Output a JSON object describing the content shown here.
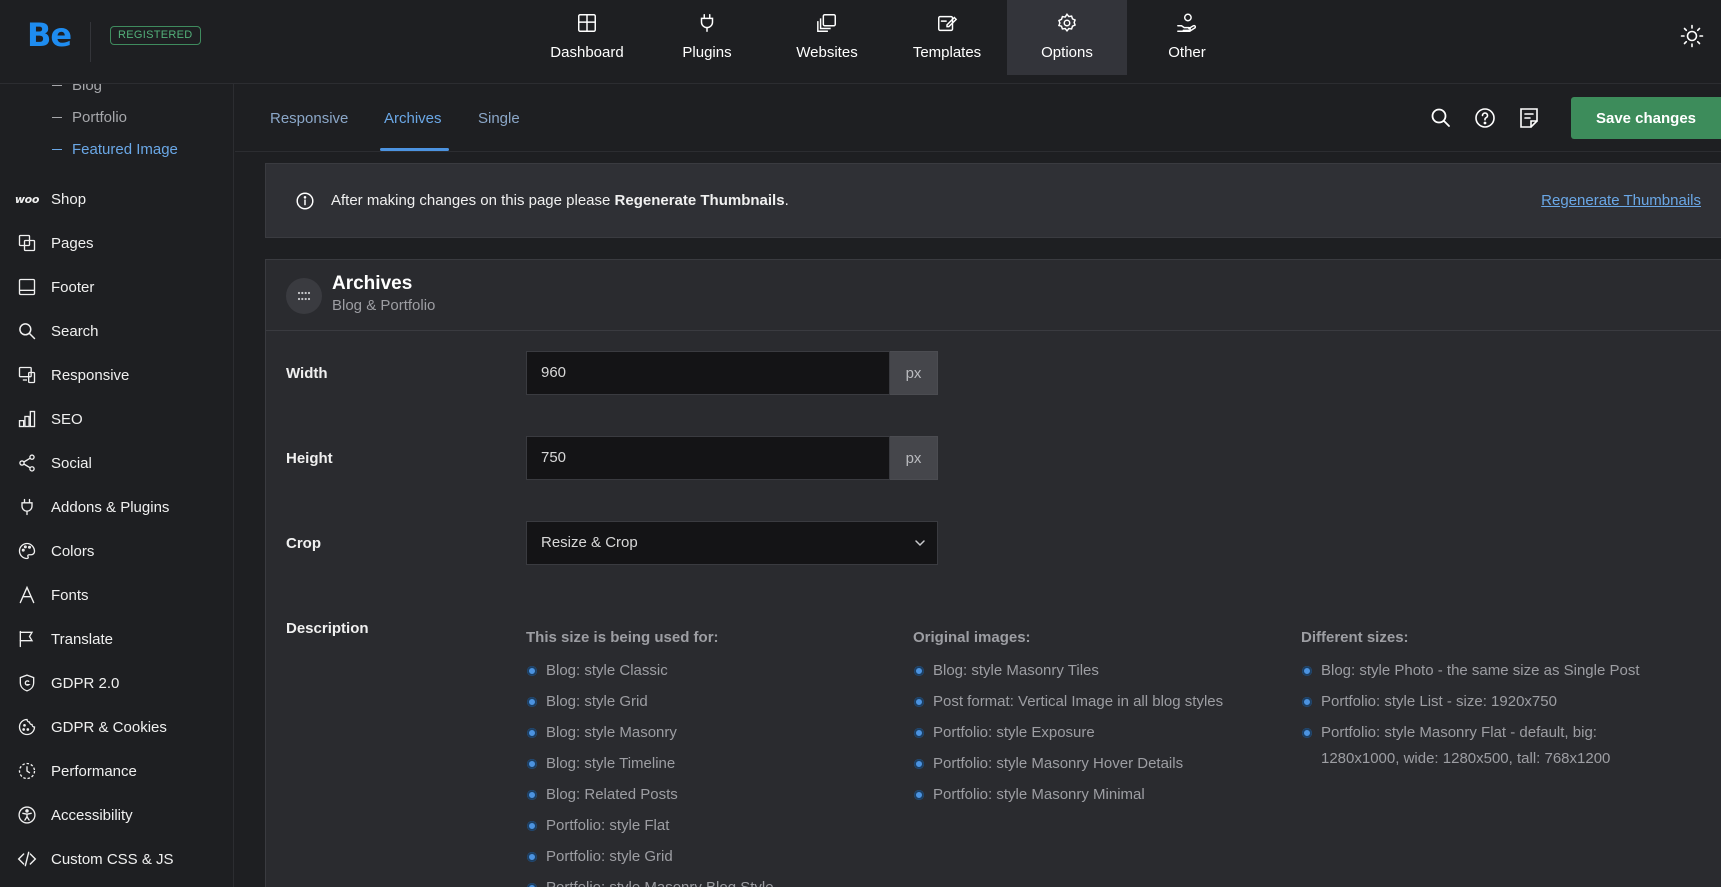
{
  "brand": {
    "logo": "Be",
    "badge": "REGISTERED",
    "accent": "#1e8cf0"
  },
  "nav": [
    {
      "label": "Dashboard",
      "icon": "dashboard-icon"
    },
    {
      "label": "Plugins",
      "icon": "plug-icon"
    },
    {
      "label": "Websites",
      "icon": "websites-icon"
    },
    {
      "label": "Templates",
      "icon": "templates-icon"
    },
    {
      "label": "Options",
      "icon": "gear-icon",
      "active": true
    },
    {
      "label": "Other",
      "icon": "hand-user-icon"
    }
  ],
  "sidebar": {
    "sub_items": [
      "Blog",
      "Portfolio",
      "Featured Image"
    ],
    "items": [
      {
        "label": "Shop",
        "icon": "woo-icon",
        "woo_text": "woo"
      },
      {
        "label": "Pages",
        "icon": "pages-icon"
      },
      {
        "label": "Footer",
        "icon": "footer-icon"
      },
      {
        "label": "Search",
        "icon": "search-icon"
      },
      {
        "label": "Responsive",
        "icon": "responsive-icon"
      },
      {
        "label": "SEO",
        "icon": "seo-icon"
      },
      {
        "label": "Social",
        "icon": "share-icon"
      },
      {
        "label": "Addons & Plugins",
        "icon": "plug-icon"
      },
      {
        "label": "Colors",
        "icon": "palette-icon"
      },
      {
        "label": "Fonts",
        "icon": "font-icon"
      },
      {
        "label": "Translate",
        "icon": "flag-icon"
      },
      {
        "label": "GDPR 2.0",
        "icon": "shield-icon"
      },
      {
        "label": "GDPR & Cookies",
        "icon": "cookie-icon"
      },
      {
        "label": "Performance",
        "icon": "performance-icon"
      },
      {
        "label": "Accessibility",
        "icon": "accessibility-icon"
      },
      {
        "label": "Custom CSS & JS",
        "icon": "code-icon"
      }
    ]
  },
  "tabs": [
    {
      "label": "Responsive"
    },
    {
      "label": "Archives",
      "active": true
    },
    {
      "label": "Single"
    }
  ],
  "toolbar": {
    "save_label": "Save changes",
    "save_color": "#3d8c5b"
  },
  "notice": {
    "text_before": "After making changes on this page please ",
    "text_bold": "Regenerate Thumbnails",
    "text_after": ".",
    "link": "Regenerate Thumbnails"
  },
  "panel": {
    "title": "Archives",
    "subtitle": "Blog & Portfolio",
    "width": {
      "label": "Width",
      "value": "960",
      "unit": "px"
    },
    "height": {
      "label": "Height",
      "value": "750",
      "unit": "px"
    },
    "crop": {
      "label": "Crop",
      "value": "Resize & Crop"
    },
    "description": {
      "label": "Description",
      "columns": [
        {
          "heading": "This size is being used for:",
          "items": [
            "Blog: style Classic",
            "Blog: style Grid",
            "Blog: style Masonry",
            "Blog: style Timeline",
            "Blog: Related Posts",
            "Portfolio: style Flat",
            "Portfolio: style Grid",
            "Portfolio: style Masonry Blog Style"
          ]
        },
        {
          "heading": "Original images:",
          "items": [
            "Blog: style Masonry Tiles",
            "Post format: Vertical Image in all blog styles",
            "Portfolio: style Exposure",
            "Portfolio: style Masonry Hover Details",
            "Portfolio: style Masonry Minimal"
          ]
        },
        {
          "heading": "Different sizes:",
          "items": [
            "Blog: style Photo - the same size as Single Post",
            "Portfolio: style List - size: 1920x750",
            "Portfolio: style Masonry Flat - default, big: 1280x1000, wide: 1280x500, tall: 768x1200"
          ]
        }
      ]
    }
  }
}
